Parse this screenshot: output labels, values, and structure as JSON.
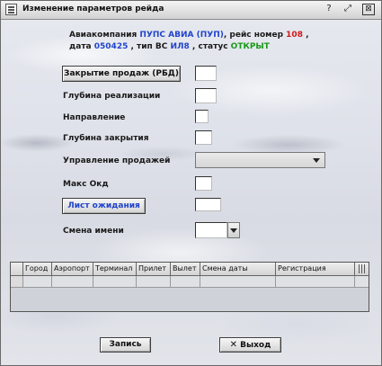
{
  "window": {
    "title": "Изменение параметров рейда",
    "controls": {
      "minimize": "?",
      "maximize": "⤢",
      "close": "⊠"
    }
  },
  "info": {
    "line1_prefix": "Авиакомпания ",
    "airline": "ПУПС АВИА (ПУП)",
    "line1_mid": ", рейс номер ",
    "flight_number": "108",
    "line1_suffix": " ,",
    "line2_prefix": "дата ",
    "date": "050425",
    "line2_mid1": " , тип ВС ",
    "aircraft_type": "ИЛ8",
    "line2_mid2": " , статус ",
    "status": "ОТКРЫТ"
  },
  "form": {
    "close_sales_button": "Закрытие продаж (РБД)",
    "depth_sale_label": "Глубина реализации",
    "direction_label": "Направление",
    "depth_close_label": "Глубина закрытия",
    "sales_mgmt_label": "Управление продажей",
    "max_okd_label": "Макс Окд",
    "waitlist_button": "Лист ожидания",
    "name_change_label": "Смена имени"
  },
  "table": {
    "columns": [
      "Город",
      "Аэропорт",
      "Терминал",
      "Прилет",
      "Вылет",
      "Смена даты",
      "Регистрация"
    ]
  },
  "footer": {
    "save_button": "Запись",
    "exit_button": "Выход",
    "exit_icon": "close-x-icon"
  }
}
